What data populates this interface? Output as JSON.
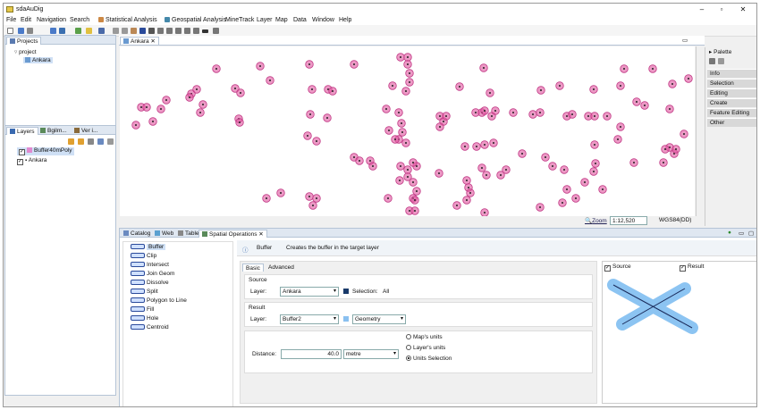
{
  "app": {
    "title": "sdaAuDig"
  },
  "menu": [
    "File",
    "Edit",
    "Navigation",
    "Search",
    "Statistical Analysis",
    "Geospatial Analysis",
    "MineTrack",
    "Layer",
    "Map",
    "Data",
    "Window",
    "Help"
  ],
  "projects": {
    "tab": "Projects",
    "root": "project",
    "map": "Ankara"
  },
  "layers": {
    "tabs": [
      "Layers",
      "Bgilm...",
      "Ver i..."
    ],
    "items": [
      {
        "name": "Buffer40mPoly",
        "checked": true
      },
      {
        "name": "Ankara",
        "checked": true
      }
    ]
  },
  "map": {
    "tab": "Ankara",
    "zoom_label": "Zoom",
    "scale": "1:12,520",
    "crs": "WGS84(DD)",
    "point_color": "#e0559f"
  },
  "palette": {
    "title": "Palette",
    "items": [
      "Info",
      "Selection",
      "Editing",
      "Create",
      "Feature Editing",
      "Other"
    ]
  },
  "bottom_tabs": [
    "Catalog",
    "Web",
    "Table",
    "Spatial Operations"
  ],
  "operations": [
    "Buffer",
    "Clip",
    "Intersect",
    "Join Geom",
    "Dissolve",
    "Split",
    "Polygon to Line",
    "Fill",
    "Hole",
    "Centroid"
  ],
  "op_header": {
    "name": "Buffer",
    "description": "Creates the buffer in the target layer"
  },
  "form": {
    "tabs": [
      "Basic",
      "Advanced"
    ],
    "source_title": "Source",
    "layer_label": "Layer:",
    "source_layer": "Ankara",
    "selection_label": "Selection:",
    "selection_value": "All",
    "result_title": "Result",
    "result_layer": "Buffer2",
    "geometry": "Geometry",
    "distance_label": "Distance:",
    "distance_value": "40.0",
    "unit": "metre",
    "radio": [
      "Map's units",
      "Layer's units",
      "Units Selection"
    ],
    "radio_selected": 2
  },
  "preview": {
    "source_label": "Source",
    "result_label": "Result"
  }
}
